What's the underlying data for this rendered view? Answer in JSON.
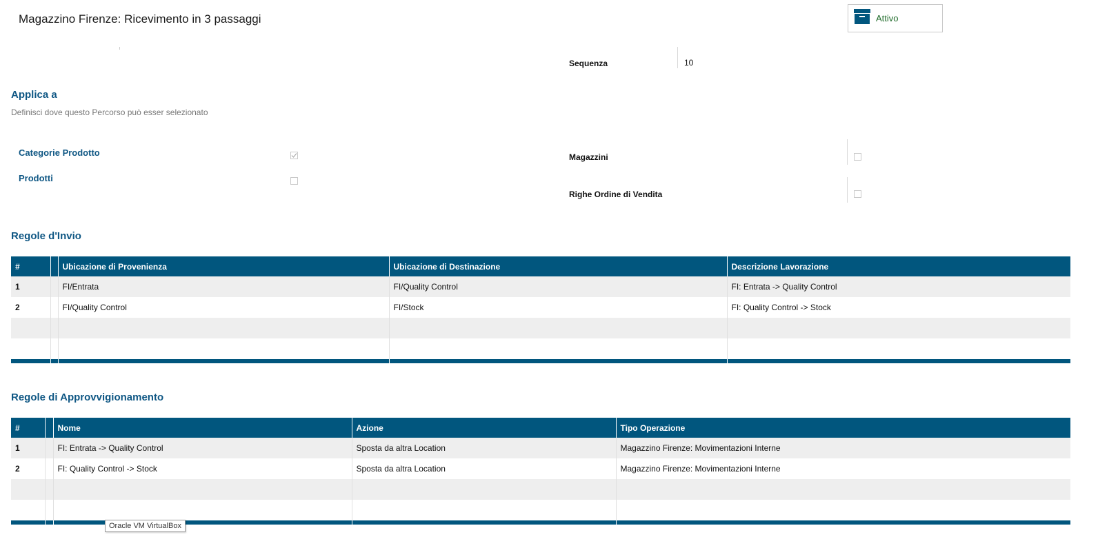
{
  "header": {
    "title": "Magazzino Firenze: Ricevimento in 3 passaggi",
    "status_button": {
      "label": "Attivo",
      "icon": "archive-box-icon"
    }
  },
  "sequence": {
    "label": "Sequenza",
    "value": "10"
  },
  "apply_to": {
    "title": "Applica a",
    "subtitle": "Definisci dove questo Percorso può esser selezionato",
    "left_fields": [
      {
        "label": "Categorie Prodotto",
        "checked": true
      },
      {
        "label": "Prodotti",
        "checked": false
      }
    ],
    "right_fields": [
      {
        "label": "Magazzini",
        "checked": false
      },
      {
        "label": "Righe Ordine di Vendita",
        "checked": false
      }
    ]
  },
  "send_rules": {
    "title": "Regole d'Invio",
    "columns": [
      "#",
      "",
      "Ubicazione di Provenienza",
      "Ubicazione di Destinazione",
      "Descrizione Lavorazione"
    ],
    "rows": [
      [
        "1",
        "",
        "FI/Entrata",
        "FI/Quality Control",
        "FI: Entrata -> Quality Control"
      ],
      [
        "2",
        "",
        "FI/Quality Control",
        "FI/Stock",
        "FI: Quality Control -> Stock"
      ]
    ]
  },
  "procurement_rules": {
    "title": "Regole di Approvvigionamento",
    "columns": [
      "#",
      "",
      "Nome",
      "Azione",
      "Tipo Operazione"
    ],
    "rows": [
      [
        "1",
        "",
        "FI: Entrata -> Quality Control",
        "Sposta da altra Location",
        "Magazzino Firenze: Movimentazioni Interne"
      ],
      [
        "2",
        "",
        "FI: Quality Control -> Stock",
        "Sposta da altra Location",
        "Magazzino Firenze: Movimentazioni Interne"
      ]
    ]
  },
  "tooltip": {
    "text": "Oracle VM VirtualBox"
  },
  "colors": {
    "accent": "#01567e",
    "title_blue": "#0f5784",
    "active_green": "#1f6b2a"
  }
}
